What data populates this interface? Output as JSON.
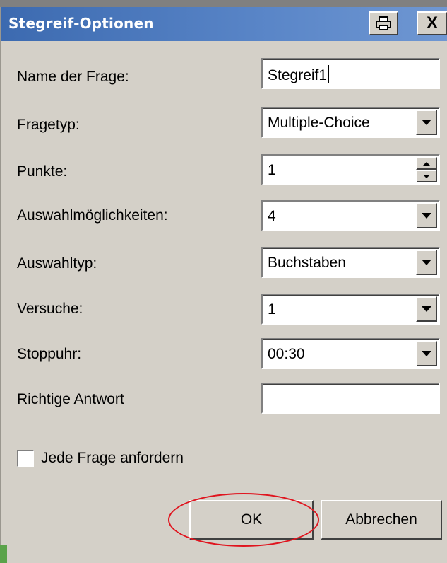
{
  "window": {
    "title": "Stegreif-Optionen",
    "print_icon": "printer-icon",
    "close_label": "X"
  },
  "form": {
    "name_label": "Name der Frage:",
    "name_value": "Stegreif1",
    "fragetyp_label": "Fragetyp:",
    "fragetyp_value": "Multiple-Choice",
    "punkte_label": "Punkte:",
    "punkte_value": "1",
    "auswahlm_label": "Auswahlmöglichkeiten:",
    "auswahlm_value": "4",
    "auswahltyp_label": "Auswahltyp:",
    "auswahltyp_value": "Buchstaben",
    "versuche_label": "Versuche:",
    "versuche_value": "1",
    "stoppuhr_label": "Stoppuhr:",
    "stoppuhr_value": "00:30",
    "richtige_label": "Richtige Antwort",
    "richtige_value": ""
  },
  "checkbox": {
    "label": "Jede Frage anfordern",
    "checked": false
  },
  "buttons": {
    "ok": "OK",
    "cancel": "Abbrechen"
  },
  "colors": {
    "titlebar": "#3c6ab0",
    "dialog_bg": "#d4d0c8",
    "annotation": "#e0141e"
  }
}
